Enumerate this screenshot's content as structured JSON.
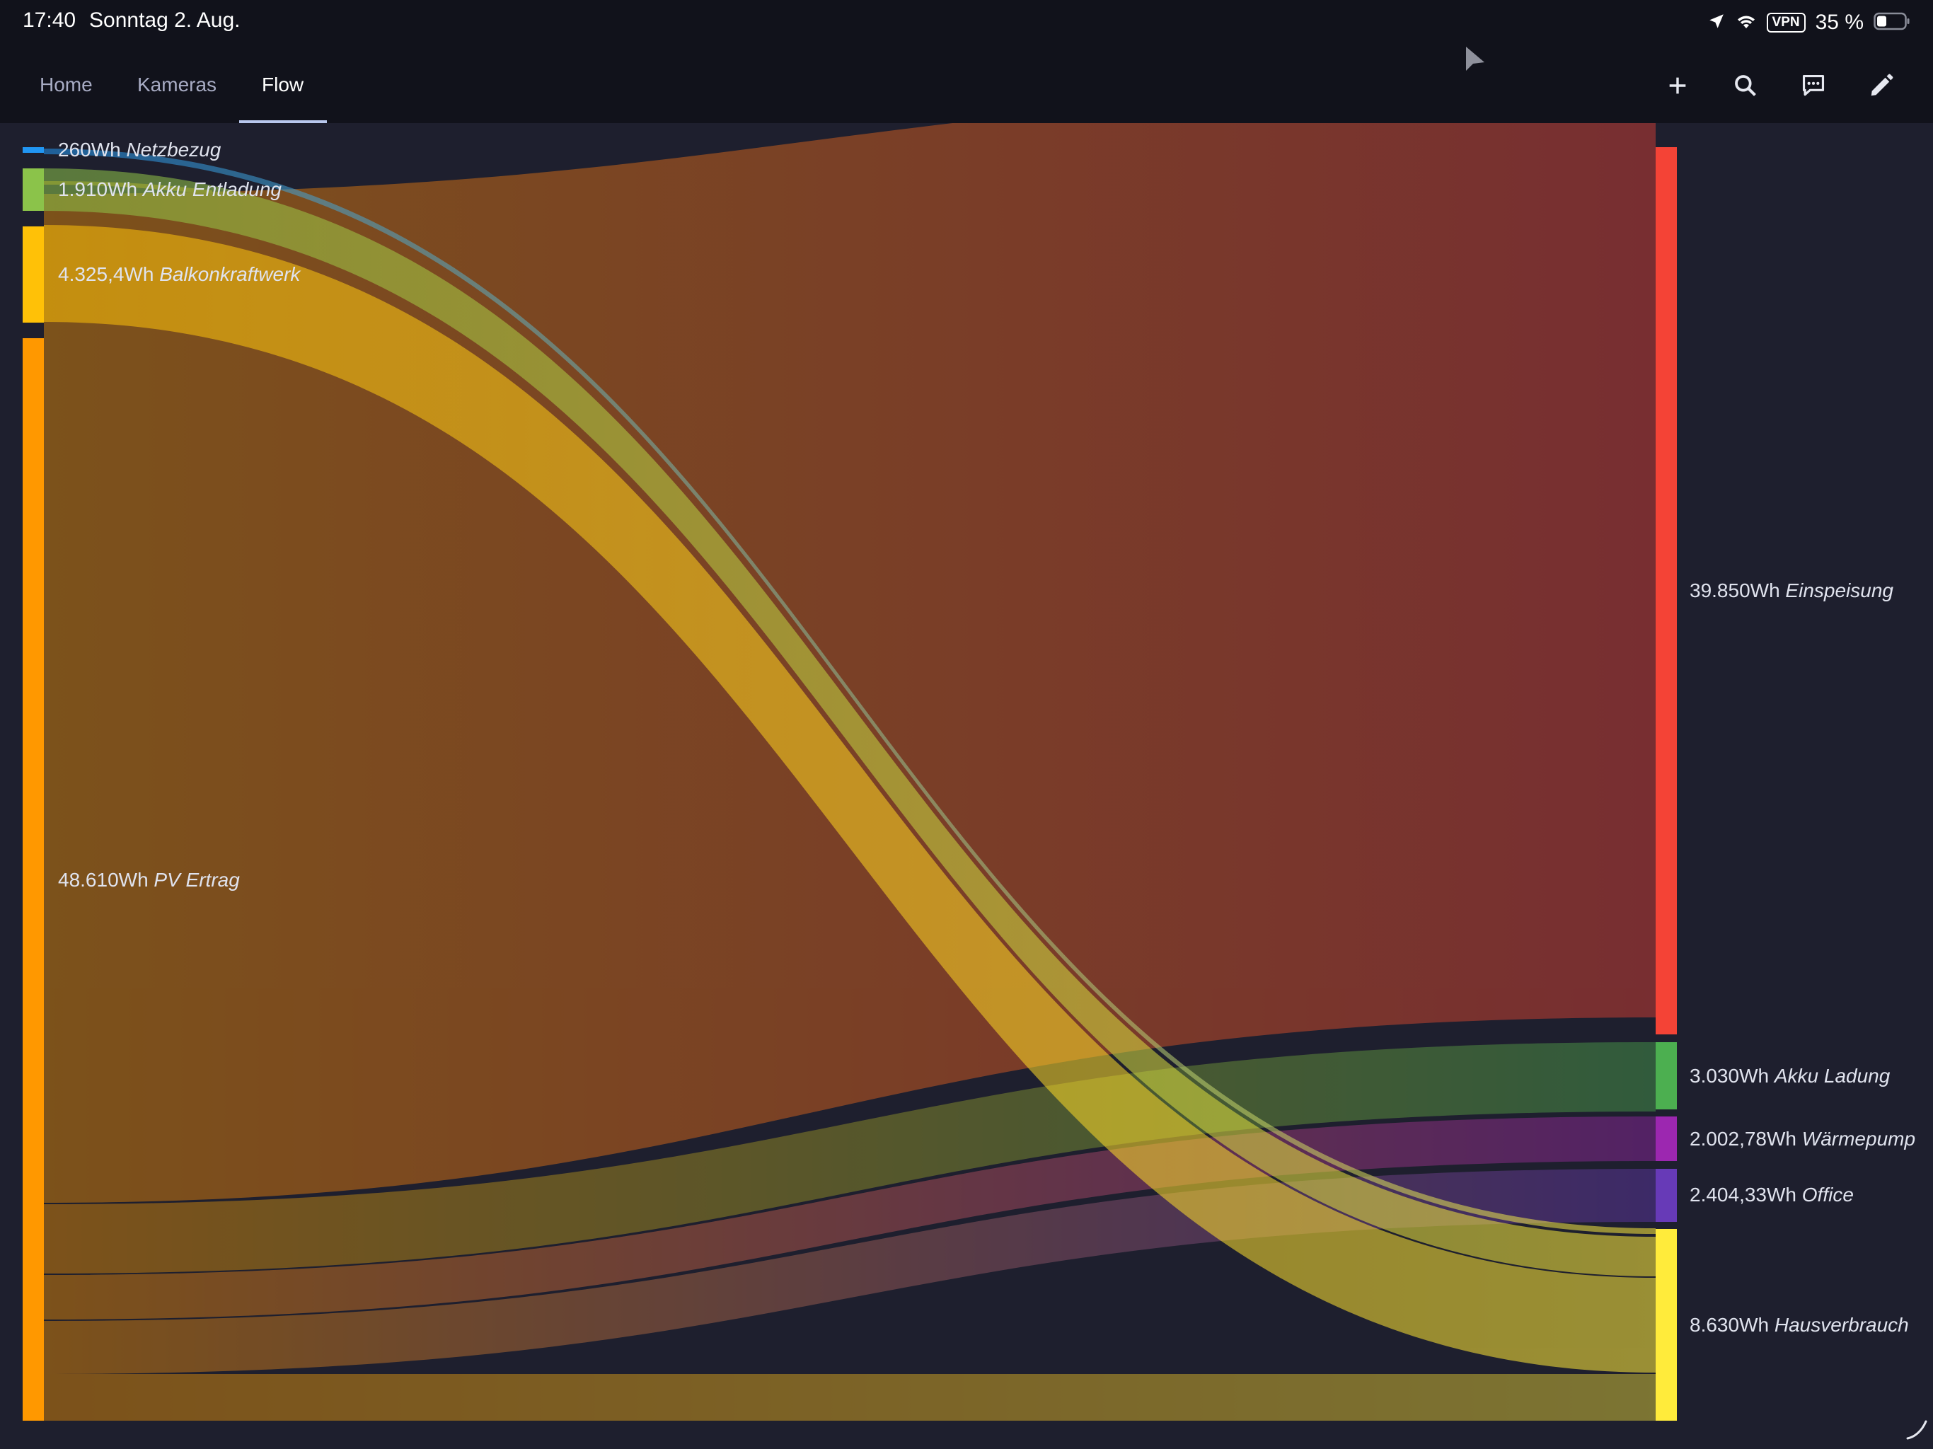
{
  "status_bar": {
    "time": "17:40",
    "date": "Sonntag 2. Aug.",
    "vpn": "VPN",
    "battery": "35 %"
  },
  "tabs": [
    {
      "label": "Home",
      "active": false
    },
    {
      "label": "Kameras",
      "active": false
    },
    {
      "label": "Flow",
      "active": true
    }
  ],
  "toolbar_icons": [
    "add-icon",
    "search-icon",
    "chat-icon",
    "edit-icon"
  ],
  "sources": [
    {
      "value": "260Wh",
      "label": "Netzbezug",
      "color": "#2196f3"
    },
    {
      "value": "1.910Wh",
      "label": "Akku Entladung",
      "color": "#8bc34a"
    },
    {
      "value": "4.325,4Wh",
      "label": "Balkonkraftwerk",
      "color": "#ffc107"
    },
    {
      "value": "48.610Wh",
      "label": "PV Ertrag",
      "color": "#ff9800"
    }
  ],
  "targets": [
    {
      "value": "39.850Wh",
      "label": "Einspeisung",
      "color": "#f44336"
    },
    {
      "value": "3.030Wh",
      "label": "Akku Ladung",
      "color": "#4caf50"
    },
    {
      "value": "2.002,78Wh",
      "label": "Wärmepump",
      "color": "#9c27b0"
    },
    {
      "value": "2.404,33Wh",
      "label": "Office",
      "color": "#673ab7"
    },
    {
      "value": "8.630Wh",
      "label": "Hausverbrauch",
      "color": "#ffeb3b"
    }
  ]
}
